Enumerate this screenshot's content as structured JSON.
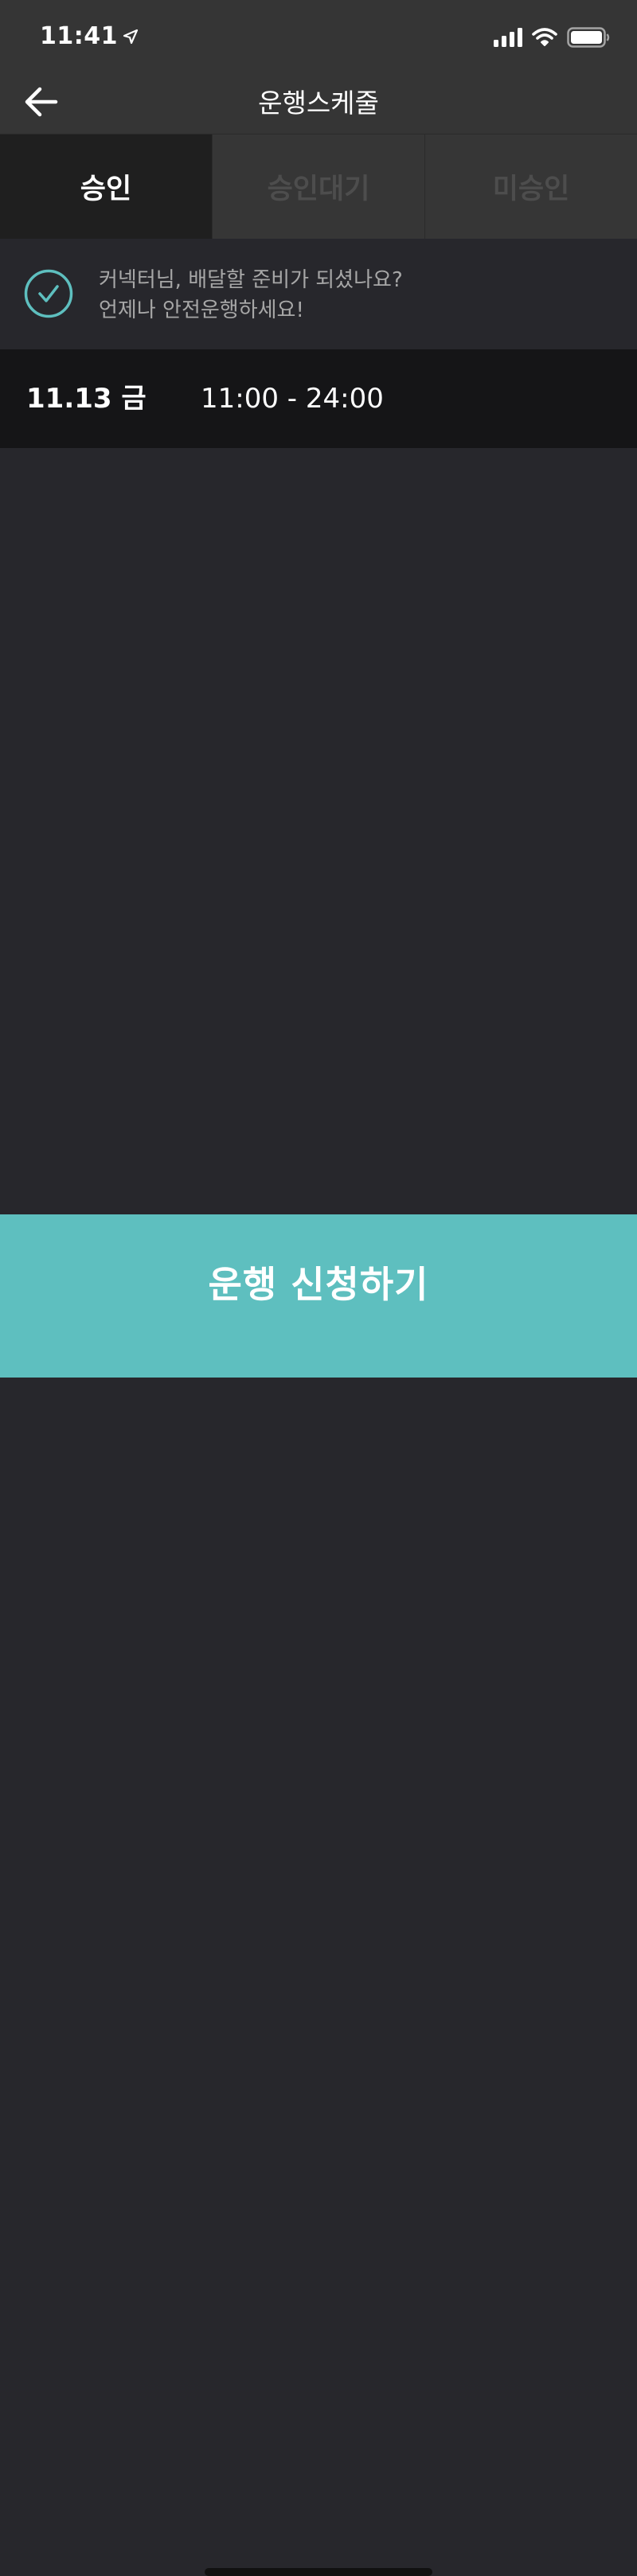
{
  "status_bar": {
    "time": "11:41",
    "icons": [
      "location-arrow-icon",
      "signal-icon",
      "wifi-icon",
      "battery-icon"
    ]
  },
  "nav": {
    "title": "운행스케줄",
    "back_icon": "arrow-left-icon"
  },
  "tabs": [
    {
      "label": "승인",
      "active": true
    },
    {
      "label": "승인대기",
      "active": false
    },
    {
      "label": "미승인",
      "active": false
    }
  ],
  "notice": {
    "icon": "check-circle-icon",
    "line1": "커넥터님, 배달할 준비가 되셨나요?",
    "line2": "언제나 안전운행하세요!"
  },
  "schedules": [
    {
      "date": "11.13 금",
      "time": "11:00 - 24:00"
    }
  ],
  "cta": {
    "label": "운행 신청하기"
  },
  "colors": {
    "accent": "#5ebfbf",
    "header_bg": "#353535",
    "body_bg": "#27272c",
    "active_tab_bg": "#1f1f1f",
    "row_bg": "#151517"
  }
}
